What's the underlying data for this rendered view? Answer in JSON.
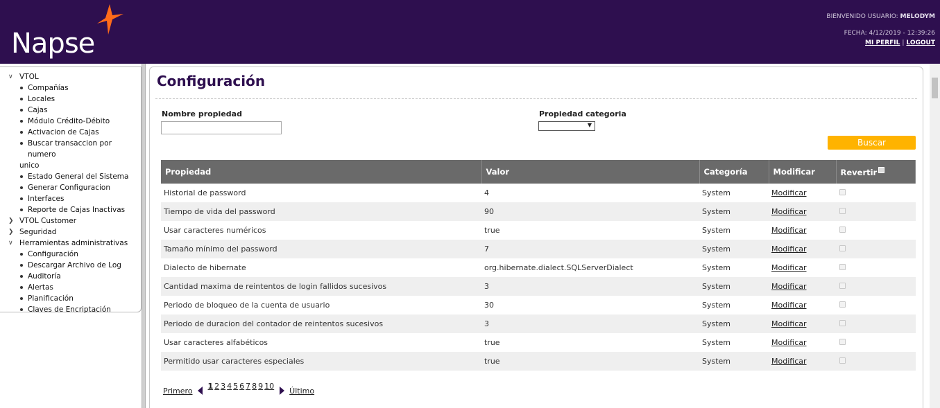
{
  "header": {
    "logo": "Napse",
    "welcome_label": "BIENVENIDO USUARIO:",
    "username": "MELODYM",
    "date_label": "FECHA: 4/12/2019 - 12:39:26",
    "profile_link": "MI PERFIL",
    "separator": "|",
    "logout_link": "LOGOUT",
    "colors": {
      "bg": "#2e0f4f",
      "accent": "#ff6b1a"
    }
  },
  "sidebar": {
    "groups": [
      {
        "label": "VTOL",
        "expanded": true,
        "items": [
          "Compañías",
          "Locales",
          "Cajas",
          "Módulo Crédito-Débito",
          "Activacion de Cajas",
          "Buscar transaccion por numero",
          "Estado General del Sistema",
          "Generar Configuracion",
          "Interfaces",
          "Reporte de Cajas Inactivas"
        ],
        "wrap_continuation": "unico"
      },
      {
        "label": "VTOL Customer",
        "expanded": false
      },
      {
        "label": "Seguridad",
        "expanded": false
      },
      {
        "label": "Herramientas administrativas",
        "expanded": true,
        "items": [
          "Configuración",
          "Descargar Archivo de Log",
          "Auditoría",
          "Alertas",
          "Planificación",
          "Claves de Encriptación"
        ]
      }
    ]
  },
  "main": {
    "title": "Configuración",
    "filters": {
      "nombre_label": "Nombre propiedad",
      "nombre_value": "",
      "categoria_label": "Propiedad categoria",
      "categoria_value": ""
    },
    "search_button": "Buscar",
    "table": {
      "headers": [
        "Propiedad",
        "Valor",
        "Categoría",
        "Modificar",
        "Revertir"
      ],
      "rows": [
        {
          "propiedad": "Historial de password",
          "valor": "4",
          "categoria": "System",
          "modificar": "Modificar"
        },
        {
          "propiedad": "Tiempo de vida del password",
          "valor": "90",
          "categoria": "System",
          "modificar": "Modificar"
        },
        {
          "propiedad": "Usar caracteres numéricos",
          "valor": "true",
          "categoria": "System",
          "modificar": "Modificar"
        },
        {
          "propiedad": "Tamaño mínimo del password",
          "valor": "7",
          "categoria": "System",
          "modificar": "Modificar"
        },
        {
          "propiedad": "Dialecto de hibernate",
          "valor": "org.hibernate.dialect.SQLServerDialect",
          "categoria": "System",
          "modificar": "Modificar"
        },
        {
          "propiedad": "Cantidad maxima de reintentos de login fallidos sucesivos",
          "valor": "3",
          "categoria": "System",
          "modificar": "Modificar"
        },
        {
          "propiedad": "Periodo de bloqueo de la cuenta de usuario",
          "valor": "30",
          "categoria": "System",
          "modificar": "Modificar"
        },
        {
          "propiedad": "Periodo de duracion del contador de reintentos sucesivos",
          "valor": "3",
          "categoria": "System",
          "modificar": "Modificar"
        },
        {
          "propiedad": "Usar caracteres alfabéticos",
          "valor": "true",
          "categoria": "System",
          "modificar": "Modificar"
        },
        {
          "propiedad": "Permitido usar caracteres especiales",
          "valor": "true",
          "categoria": "System",
          "modificar": "Modificar"
        }
      ]
    },
    "pager": {
      "first": "Primero",
      "last": "Último",
      "pages": [
        "1",
        "2",
        "3",
        "4",
        "5",
        "6",
        "7",
        "8",
        "9",
        "10"
      ],
      "current": "1"
    }
  }
}
